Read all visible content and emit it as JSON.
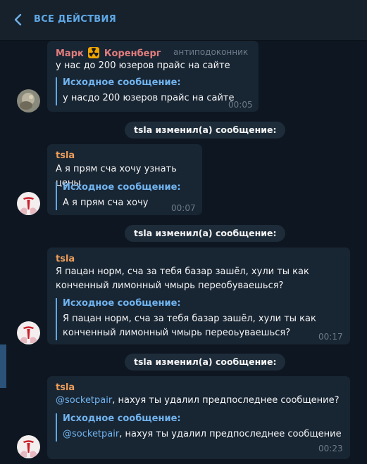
{
  "header": {
    "title": "ВСЕ ДЕЙСТВИЯ"
  },
  "messages": [
    {
      "sender_first": "Марк",
      "emoji": "☢",
      "sender_last": "Коренберг",
      "badge": "антиподоконник",
      "text": "у нас до 200 юзеров прайс на сайте",
      "quote_title": "Исходное сообщение:",
      "quote_text": "у насдо 200 юзеров прайс на сайте",
      "time": "00:05"
    },
    {
      "sender": "tsla",
      "text": "А я прям сча хочу узнать цены",
      "quote_title": "Исходное сообщение:",
      "quote_text": "А я прям сча хочу",
      "time": "00:07"
    },
    {
      "sender": "tsla",
      "text": "Я пацан норм, сча за тебя базар зашёл, хули ты как конченный лимонный чмырь переобуваешься?",
      "quote_title": "Исходное сообщение:",
      "quote_text": "Я пацан норм, сча за тебя базар зашёл, хули ты как конченный лимонный чмырь переоьуваешься?",
      "time": "00:17"
    },
    {
      "sender": "tsla",
      "mention": "@socketpair",
      "text": ", нахуя ты удалил предпоследнее сообщение?",
      "quote_title": "Исходное сообщение:",
      "quote_mention": "@socketpair",
      "quote_text": ", нахуя ты удалил предпоследнее сообщение",
      "time": "00:23"
    }
  ],
  "services": [
    {
      "text": "tsla изменил(а) сообщение:"
    },
    {
      "text": "tsla изменил(а) сообщение:"
    },
    {
      "text": "tsla изменил(а) сообщение:"
    }
  ],
  "colors": {
    "background": "#0e1621",
    "header": "#17212b",
    "bubble": "#182533",
    "accent": "#5fa8e6",
    "sender_orange": "#ed9e5b",
    "sender_red": "#e27d7d"
  },
  "icons": {
    "back": "chevron-left-icon",
    "radioactive": "radioactive-emoji",
    "tesla": "tesla-logo-avatar"
  }
}
